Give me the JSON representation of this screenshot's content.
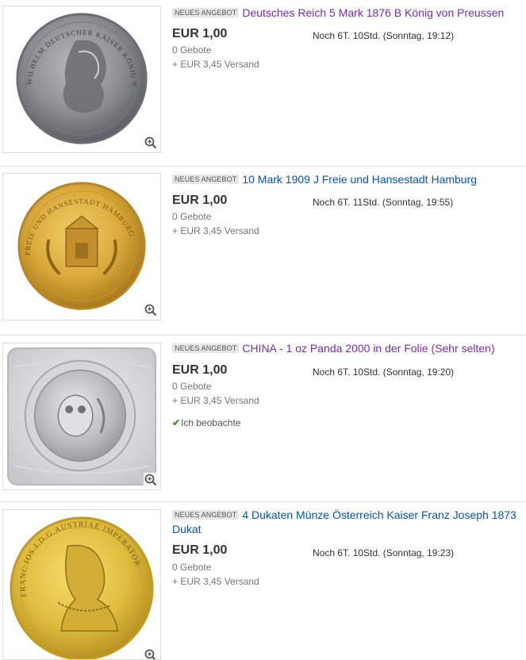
{
  "items": [
    {
      "badge": "NEUES ANGEBOT",
      "title": "Deutsches Reich 5 Mark 1876 B König von Preussen",
      "price": "EUR 1,00",
      "time_left": "Noch 6T. 10Std. (Sonntag, 19:12)",
      "bids": "0 Gebote",
      "shipping": "+ EUR 3,45 Versand",
      "coin_legend": "WILHELM DEUTSCHER KAISER KÖNIG V. PREUSSEN"
    },
    {
      "badge": "NEUES ANGEBOT",
      "title": "10 Mark 1909 J Freie und Hansestadt Hamburg",
      "price": "EUR 1,00",
      "time_left": "Noch 6T. 11Std. (Sonntag, 19:55)",
      "bids": "0 Gebote",
      "shipping": "+ EUR 3,45 Versand",
      "coin_legend": "FREIE UND HANSESTADT HAMBURG"
    },
    {
      "badge": "NEUES ANGEBOT",
      "title": "CHINA - 1 oz Panda 2000 in der Folie (Sehr selten)",
      "price": "EUR 1,00",
      "time_left": "Noch 6T. 10Std. (Sonntag, 19:20)",
      "bids": "0 Gebote",
      "shipping": "+ EUR 3,45 Versand",
      "watching": "Ich beobachte"
    },
    {
      "badge": "NEUES ANGEBOT",
      "title": "4 Dukaten Münze Österreich Kaiser Franz Joseph 1873 Dukat",
      "price": "EUR 1,00",
      "time_left": "Noch 6T. 10Std. (Sonntag, 19:23)",
      "bids": "0 Gebote",
      "shipping": "+ EUR 3,45 Versand",
      "coin_legend": "FRANC.IOS.I.D.G.AUSTRIAE IMPERATOR"
    }
  ],
  "colors": {
    "link": "#0654ba",
    "link_visited": "#7b2bb0",
    "watch_check": "#3d9b1d"
  },
  "icons": {
    "zoom": "zoom-in-icon",
    "watch": "check-icon"
  }
}
